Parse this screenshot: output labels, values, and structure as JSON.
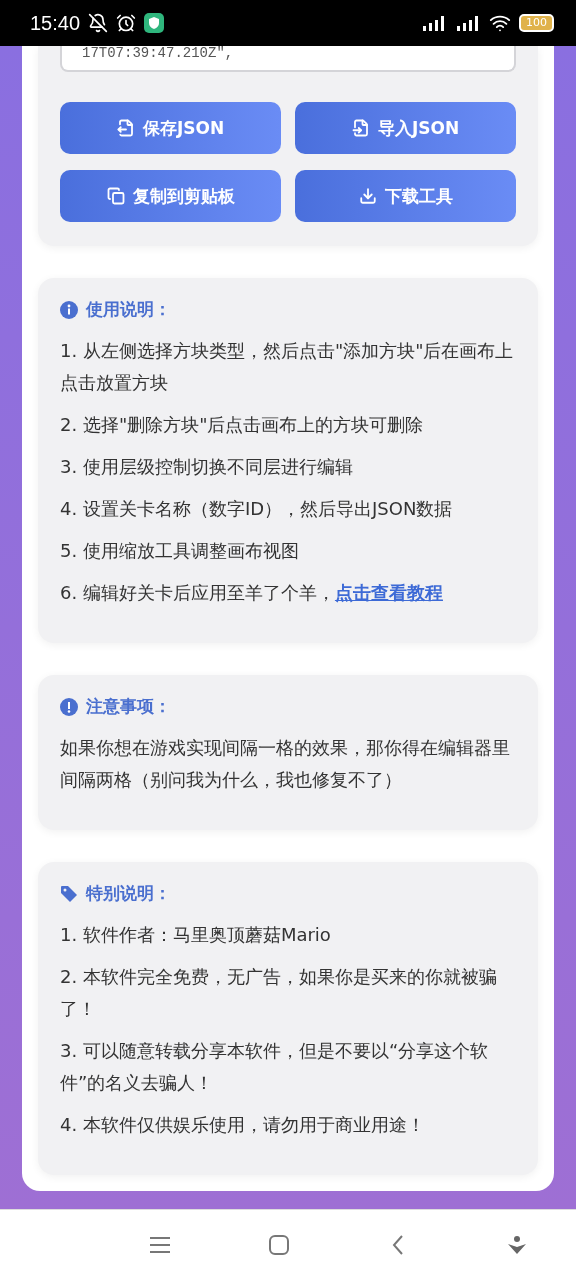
{
  "status_bar": {
    "time": "15:40",
    "battery": "100"
  },
  "json_preview": {
    "line": "17T07:39:47.210Z\","
  },
  "buttons": [
    {
      "label": "保存JSON",
      "kind": "export"
    },
    {
      "label": "导入JSON",
      "kind": "import"
    },
    {
      "label": "复制到剪贴板",
      "kind": "copy"
    },
    {
      "label": "下载工具",
      "kind": "download"
    }
  ],
  "sections": [
    {
      "kind": "info",
      "title": "使用说明：",
      "items": [
        {
          "text": "1. 从左侧选择方块类型，然后点击\"添加方块\"后在画布上点击放置方块"
        },
        {
          "text": "2. 选择\"删除方块\"后点击画布上的方块可删除"
        },
        {
          "text": "3. 使用层级控制切换不同层进行编辑"
        },
        {
          "text": "4. 设置关卡名称（数字ID），然后导出JSON数据"
        },
        {
          "text": "5. 使用缩放工具调整画布视图"
        },
        {
          "text": "6. 编辑好关卡后应用至羊了个羊，",
          "link": "点击查看教程"
        }
      ]
    },
    {
      "kind": "warning",
      "title": "注意事项：",
      "items": [
        {
          "text": "如果你想在游戏实现间隔一格的效果，那你得在编辑器里间隔两格（别问我为什么，我也修复不了）"
        }
      ]
    },
    {
      "kind": "tag",
      "title": "特别说明：",
      "items": [
        {
          "text": "1. 软件作者：马里奥顶蘑菇Mario"
        },
        {
          "text": "2. 本软件完全免费，无广告，如果你是买来的你就被骗了！"
        },
        {
          "text": "3. 可以随意转载分享本软件，但是不要以“分享这个软件”的名义去骗人！"
        },
        {
          "text": "4. 本软件仅供娱乐使用，请勿用于商业用途！"
        }
      ]
    }
  ]
}
